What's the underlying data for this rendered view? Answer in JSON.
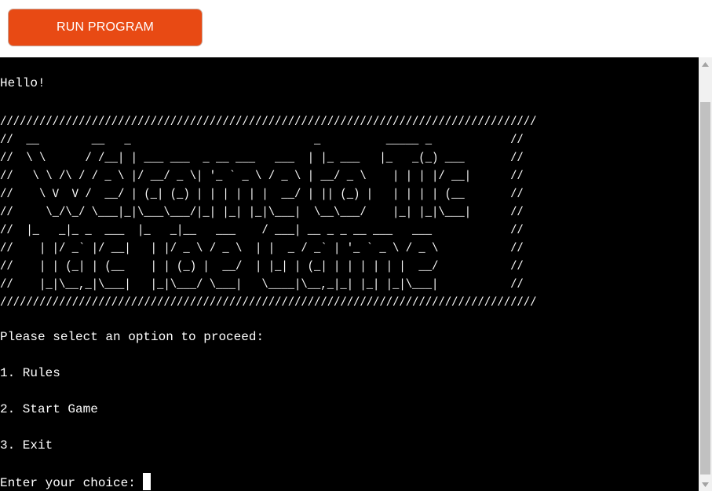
{
  "toolbar": {
    "run_label": "RUN PROGRAM"
  },
  "terminal": {
    "greeting": "Hello!",
    "banner": [
      "//////////////////////////////////////////////////////////////////////////////////",
      "//  __        __   _                            _          _____ _            //",
      "//  \\ \\      / /__| | ___ ___  _ __ ___   ___  | |_ ___   |_   _(_) ___       //",
      "//   \\ \\ /\\ / / _ \\ |/ __/ _ \\| '_ ` _ \\ / _ \\ | __/ _ \\    | | | |/ __|      //",
      "//    \\ V  V /  __/ | (_| (_) | | | | | |  __/ | || (_) |   | | | | (__       //",
      "//     \\_/\\_/ \\___|_|\\___\\___/|_| |_| |_|\\___|  \\__\\___/    |_| |_|\\___|      //",
      "//  |_   _|_ _  ___  |_   _|__   ___    / ___| __ _ _ __ ___   ___            //",
      "//    | |/ _` |/ __|   | |/ _ \\ / _ \\  | |  _ / _` | '_ ` _ \\ / _ \\           //",
      "//    | | (_| | (__    | | (_) |  __/  | |_| | (_| | | | | | |  __/           //",
      "//    |_|\\__,_|\\___|   |_|\\___/ \\___|   \\____|\\__,_|_| |_| |_|\\___|           //",
      "//////////////////////////////////////////////////////////////////////////////////"
    ],
    "prompt": "Please select an option to proceed:",
    "options": [
      "1. Rules",
      "2. Start Game",
      "3. Exit"
    ],
    "input_prompt": "Enter your choice: "
  },
  "colors": {
    "run_button": "#e84a14",
    "terminal_bg": "#000000",
    "terminal_fg": "#ffffff"
  },
  "icons": {
    "scroll_up": "triangle-up-icon",
    "scroll_down": "triangle-down-icon"
  }
}
